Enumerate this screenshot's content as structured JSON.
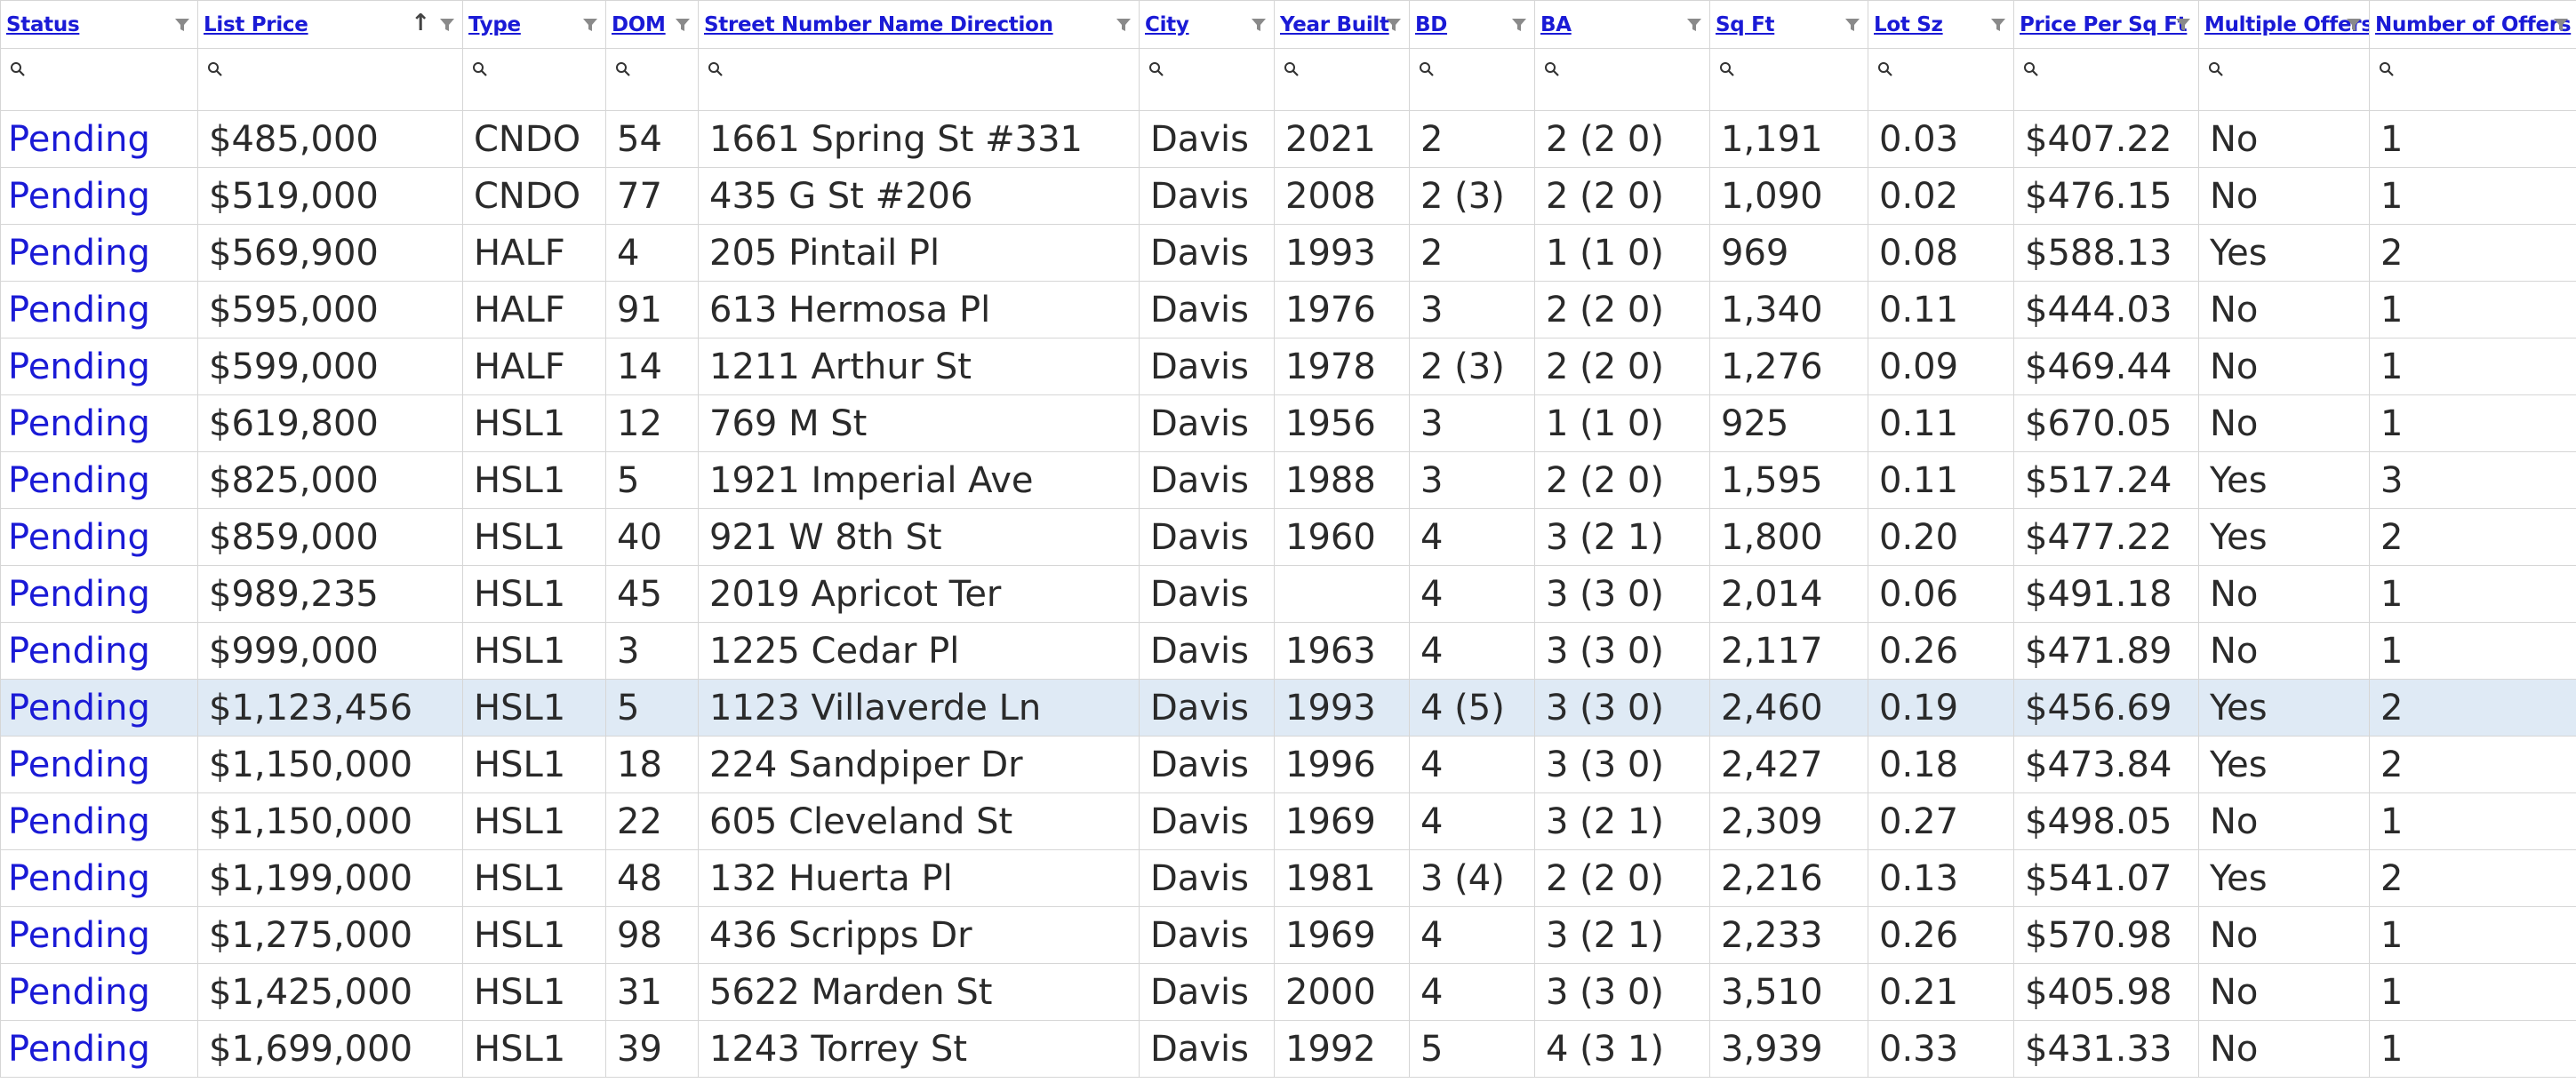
{
  "columns": [
    {
      "key": "status",
      "label": "Status"
    },
    {
      "key": "list_price",
      "label": "List Price"
    },
    {
      "key": "type",
      "label": "Type"
    },
    {
      "key": "dom",
      "label": "DOM"
    },
    {
      "key": "address",
      "label": "Street Number Name Direction"
    },
    {
      "key": "city",
      "label": "City"
    },
    {
      "key": "year_built",
      "label": "Year Built"
    },
    {
      "key": "bd",
      "label": "BD"
    },
    {
      "key": "ba",
      "label": "BA"
    },
    {
      "key": "sqft",
      "label": "Sq Ft"
    },
    {
      "key": "lot",
      "label": "Lot Sz"
    },
    {
      "key": "ppsf",
      "label": "Price Per Sq Ft"
    },
    {
      "key": "multi",
      "label": "Multiple Offers"
    },
    {
      "key": "offers",
      "label": "Number of Offers"
    }
  ],
  "sort": {
    "column": "List Price",
    "direction": "ascending"
  },
  "rows": [
    [
      "Pending",
      "$485,000",
      "CNDO",
      "54",
      "1661 Spring St #331",
      "Davis",
      "2021",
      "2",
      "2 (2 0)",
      "1,191",
      "0.03",
      "$407.22",
      "No",
      "1"
    ],
    [
      "Pending",
      "$519,000",
      "CNDO",
      "77",
      "435 G St #206",
      "Davis",
      "2008",
      "2 (3)",
      "2 (2 0)",
      "1,090",
      "0.02",
      "$476.15",
      "No",
      "1"
    ],
    [
      "Pending",
      "$569,900",
      "HALF",
      "4",
      "205 Pintail Pl",
      "Davis",
      "1993",
      "2",
      "1 (1 0)",
      "969",
      "0.08",
      "$588.13",
      "Yes",
      "2"
    ],
    [
      "Pending",
      "$595,000",
      "HALF",
      "91",
      "613 Hermosa Pl",
      "Davis",
      "1976",
      "3",
      "2 (2 0)",
      "1,340",
      "0.11",
      "$444.03",
      "No",
      "1"
    ],
    [
      "Pending",
      "$599,000",
      "HALF",
      "14",
      "1211 Arthur St",
      "Davis",
      "1978",
      "2 (3)",
      "2 (2 0)",
      "1,276",
      "0.09",
      "$469.44",
      "No",
      "1"
    ],
    [
      "Pending",
      "$619,800",
      "HSL1",
      "12",
      "769 M St",
      "Davis",
      "1956",
      "3",
      "1 (1 0)",
      "925",
      "0.11",
      "$670.05",
      "No",
      "1"
    ],
    [
      "Pending",
      "$825,000",
      "HSL1",
      "5",
      "1921 Imperial Ave",
      "Davis",
      "1988",
      "3",
      "2 (2 0)",
      "1,595",
      "0.11",
      "$517.24",
      "Yes",
      "3"
    ],
    [
      "Pending",
      "$859,000",
      "HSL1",
      "40",
      "921 W 8th St",
      "Davis",
      "1960",
      "4",
      "3 (2 1)",
      "1,800",
      "0.20",
      "$477.22",
      "Yes",
      "2"
    ],
    [
      "Pending",
      "$989,235",
      "HSL1",
      "45",
      "2019 Apricot Ter",
      "Davis",
      "",
      "4",
      "3 (3 0)",
      "2,014",
      "0.06",
      "$491.18",
      "No",
      "1"
    ],
    [
      "Pending",
      "$999,000",
      "HSL1",
      "3",
      "1225 Cedar Pl",
      "Davis",
      "1963",
      "4",
      "3 (3 0)",
      "2,117",
      "0.26",
      "$471.89",
      "No",
      "1"
    ],
    [
      "Pending",
      "$1,123,456",
      "HSL1",
      "5",
      "1123 Villaverde Ln",
      "Davis",
      "1993",
      "4 (5)",
      "3 (3 0)",
      "2,460",
      "0.19",
      "$456.69",
      "Yes",
      "2"
    ],
    [
      "Pending",
      "$1,150,000",
      "HSL1",
      "18",
      "224 Sandpiper Dr",
      "Davis",
      "1996",
      "4",
      "3 (3 0)",
      "2,427",
      "0.18",
      "$473.84",
      "Yes",
      "2"
    ],
    [
      "Pending",
      "$1,150,000",
      "HSL1",
      "22",
      "605 Cleveland St",
      "Davis",
      "1969",
      "4",
      "3 (2 1)",
      "2,309",
      "0.27",
      "$498.05",
      "No",
      "1"
    ],
    [
      "Pending",
      "$1,199,000",
      "HSL1",
      "48",
      "132 Huerta Pl",
      "Davis",
      "1981",
      "3 (4)",
      "2 (2 0)",
      "2,216",
      "0.13",
      "$541.07",
      "Yes",
      "2"
    ],
    [
      "Pending",
      "$1,275,000",
      "HSL1",
      "98",
      "436 Scripps Dr",
      "Davis",
      "1969",
      "4",
      "3 (2 1)",
      "2,233",
      "0.26",
      "$570.98",
      "No",
      "1"
    ],
    [
      "Pending",
      "$1,425,000",
      "HSL1",
      "31",
      "5622 Marden St",
      "Davis",
      "2000",
      "4",
      "3 (3 0)",
      "3,510",
      "0.21",
      "$405.98",
      "No",
      "1"
    ],
    [
      "Pending",
      "$1,699,000",
      "HSL1",
      "39",
      "1243 Torrey St",
      "Davis",
      "1992",
      "5",
      "4 (3 1)",
      "3,939",
      "0.33",
      "$431.33",
      "No",
      "1"
    ]
  ],
  "selected_row": 10,
  "icons": {
    "filter": "funnel-icon",
    "search": "magnifier-icon",
    "sort": "sort-up-arrow-icon"
  },
  "colors": {
    "link": "#1a1ad6",
    "selected_row_bg": "#dfeaf5",
    "grid": "#d6d6d6"
  }
}
